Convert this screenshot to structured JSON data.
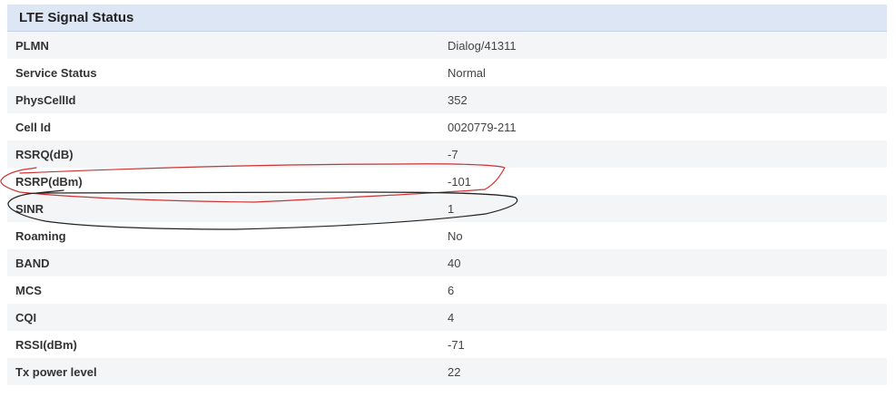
{
  "panel": {
    "title": "LTE Signal Status"
  },
  "rows": [
    {
      "label": "PLMN",
      "value": "Dialog/41311"
    },
    {
      "label": "Service Status",
      "value": "Normal"
    },
    {
      "label": "PhysCellId",
      "value": "352"
    },
    {
      "label": "Cell Id",
      "value": "0020779-211"
    },
    {
      "label": "RSRQ(dB)",
      "value": "-7"
    },
    {
      "label": "RSRP(dBm)",
      "value": "-101"
    },
    {
      "label": "SINR",
      "value": "1"
    },
    {
      "label": "Roaming",
      "value": "No"
    },
    {
      "label": "BAND",
      "value": "40"
    },
    {
      "label": "MCS",
      "value": "6"
    },
    {
      "label": "CQI",
      "value": "4"
    },
    {
      "label": "RSSI(dBm)",
      "value": "-71"
    },
    {
      "label": "Tx power level",
      "value": "22"
    }
  ],
  "annotations": {
    "rsrp_circle_color": "#cc3333",
    "sinr_circle_color": "#222222"
  }
}
